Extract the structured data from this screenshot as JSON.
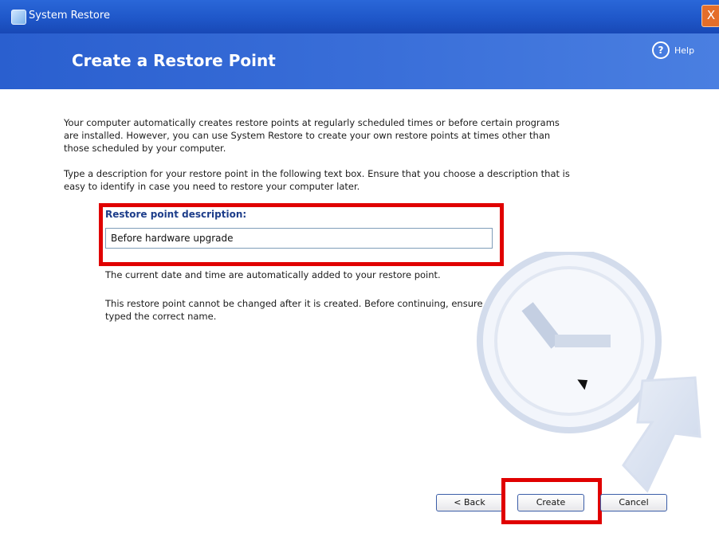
{
  "window": {
    "title": "System Restore",
    "close_label": "X"
  },
  "header": {
    "title": "Create a Restore Point",
    "help_label": "Help",
    "help_glyph": "?"
  },
  "content": {
    "paragraph1": "Your computer automatically creates restore points at regularly scheduled times or before certain programs are installed. However, you can use System Restore to create your own restore points at times other than those scheduled by your computer.",
    "paragraph2": "Type a description for your restore point in the following text box. Ensure that you choose a description that is easy to identify in case you need to restore your computer later.",
    "input_label": "Restore point description:",
    "input_value": "Before hardware upgrade",
    "note1": "The current date and time are automatically added to your restore point.",
    "note2": "This restore point cannot be changed after it is created. Before continuing, ensure that you have typed the correct name."
  },
  "buttons": {
    "back": "< Back",
    "create": "Create",
    "cancel": "Cancel"
  },
  "colors": {
    "titlebar": "#1f57c9",
    "header": "#3a6fd9",
    "highlight": "#e00000"
  },
  "icons": {
    "app": "system-restore-icon",
    "help": "help-icon",
    "watermark": "clock-arrow-watermark-icon"
  }
}
